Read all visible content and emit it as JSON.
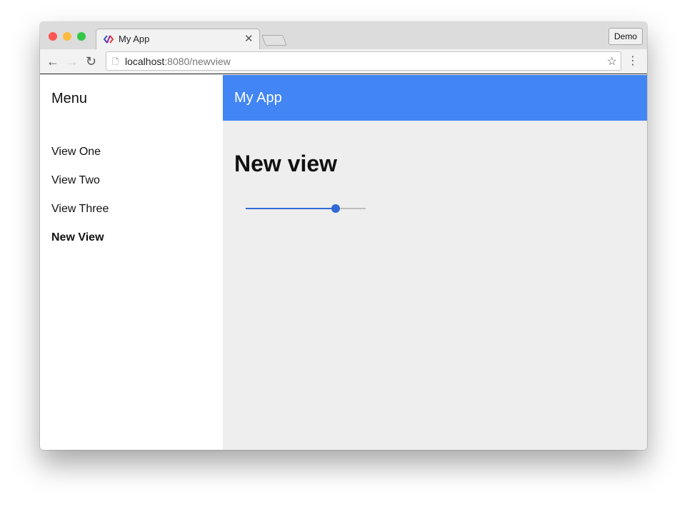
{
  "browser": {
    "tab_title": "My App",
    "profile_button": "Demo",
    "url_host": "localhost",
    "url_path": ":8080/newview"
  },
  "sidebar": {
    "title": "Menu",
    "items": [
      {
        "label": "View One"
      },
      {
        "label": "View Two"
      },
      {
        "label": "View Three"
      },
      {
        "label": "New View",
        "active": true
      }
    ]
  },
  "header": {
    "title": "My App",
    "color": "#4285f4"
  },
  "main": {
    "heading": "New view",
    "slider": {
      "value": 75,
      "min": 0,
      "max": 100,
      "color": "#3367d6"
    }
  }
}
